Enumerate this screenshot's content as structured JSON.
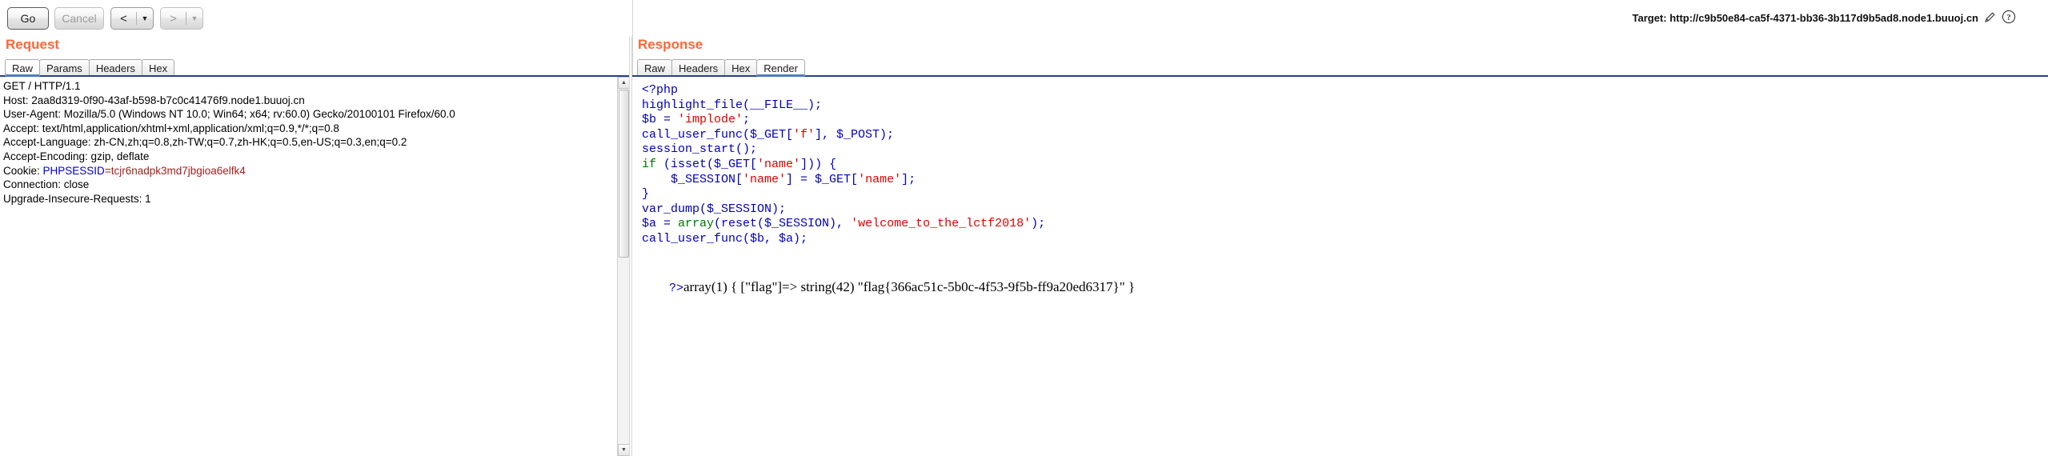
{
  "toolbar": {
    "go_label": "Go",
    "cancel_label": "Cancel",
    "back_label": "<",
    "back_arrow": "▼",
    "forward_label": ">",
    "forward_arrow": "▼"
  },
  "target": {
    "label": "Target: http://c9b50e84-ca5f-4371-bb36-3b117d9b5ad8.node1.buuoj.cn",
    "pencil_icon": "pencil-icon",
    "help_icon": "help-icon"
  },
  "request": {
    "title": "Request",
    "tabs": [
      {
        "label": "Raw",
        "active": true
      },
      {
        "label": "Params",
        "active": false
      },
      {
        "label": "Headers",
        "active": false
      },
      {
        "label": "Hex",
        "active": false
      }
    ],
    "lines": [
      "GET / HTTP/1.1",
      "Host: 2aa8d319-0f90-43af-b598-b7c0c41476f9.node1.buuoj.cn",
      "User-Agent: Mozilla/5.0 (Windows NT 10.0; Win64; x64; rv:60.0) Gecko/20100101 Firefox/60.0",
      "Accept: text/html,application/xhtml+xml,application/xml;q=0.9,*/*;q=0.8",
      "Accept-Language: zh-CN,zh;q=0.8,zh-TW;q=0.7,zh-HK;q=0.5,en-US;q=0.3,en;q=0.2",
      "Accept-Encoding: gzip, deflate"
    ],
    "cookie_prefix": "Cookie: ",
    "cookie_name": "PHPSESSID",
    "cookie_eq": "=",
    "cookie_value": "tcjr6nadpk3md7jbgioa6elfk4",
    "lines_after": [
      "Connection: close",
      "Upgrade-Insecure-Requests: 1"
    ]
  },
  "response": {
    "title": "Response",
    "tabs": [
      {
        "label": "Raw",
        "active": false
      },
      {
        "label": "Headers",
        "active": false
      },
      {
        "label": "Hex",
        "active": false
      },
      {
        "label": "Render",
        "active": true
      }
    ],
    "code": [
      {
        "segments": [
          {
            "t": "<?php",
            "c": "c-default"
          }
        ]
      },
      {
        "segments": [
          {
            "t": "highlight_file(__FILE__);",
            "c": "c-default"
          }
        ]
      },
      {
        "segments": [
          {
            "t": "$b = ",
            "c": "c-default"
          },
          {
            "t": "'implode'",
            "c": "c-string"
          },
          {
            "t": ";",
            "c": "c-default"
          }
        ]
      },
      {
        "segments": [
          {
            "t": "call_user_func($_GET[",
            "c": "c-default"
          },
          {
            "t": "'f'",
            "c": "c-string"
          },
          {
            "t": "], $_POST);",
            "c": "c-default"
          }
        ]
      },
      {
        "segments": [
          {
            "t": "session_start();",
            "c": "c-default"
          }
        ]
      },
      {
        "segments": [
          {
            "t": "if ",
            "c": "c-keyword"
          },
          {
            "t": "(isset($_GET[",
            "c": "c-default"
          },
          {
            "t": "'name'",
            "c": "c-string"
          },
          {
            "t": "])) {",
            "c": "c-default"
          }
        ]
      },
      {
        "segments": [
          {
            "t": "    $_SESSION[",
            "c": "c-default"
          },
          {
            "t": "'name'",
            "c": "c-string"
          },
          {
            "t": "] = $_GET[",
            "c": "c-default"
          },
          {
            "t": "'name'",
            "c": "c-string"
          },
          {
            "t": "];",
            "c": "c-default"
          }
        ]
      },
      {
        "segments": [
          {
            "t": "}",
            "c": "c-default"
          }
        ]
      },
      {
        "segments": [
          {
            "t": "var_dump($_SESSION);",
            "c": "c-default"
          }
        ]
      },
      {
        "segments": [
          {
            "t": "$a = ",
            "c": "c-default"
          },
          {
            "t": "array",
            "c": "c-keyword"
          },
          {
            "t": "(reset($_SESSION), ",
            "c": "c-default"
          },
          {
            "t": "'welcome_to_the_lctf2018'",
            "c": "c-string"
          },
          {
            "t": ");",
            "c": "c-default"
          }
        ]
      },
      {
        "segments": [
          {
            "t": "call_user_func($b, $a);",
            "c": "c-default"
          }
        ]
      }
    ],
    "dump_prefix": "?>",
    "dump_text": "array(1) { [\"flag\"]=> string(42) \"flag{366ac51c-5b0c-4f53-9f5b-ff9a20ed6317}\" }"
  },
  "colors": {
    "panel_title": "#ff6633",
    "tab_active_underline": "#4f7cbf",
    "tabstrip_underline": "#27408b",
    "cookie_name": "#0000cd",
    "cookie_value": "#a52020"
  }
}
